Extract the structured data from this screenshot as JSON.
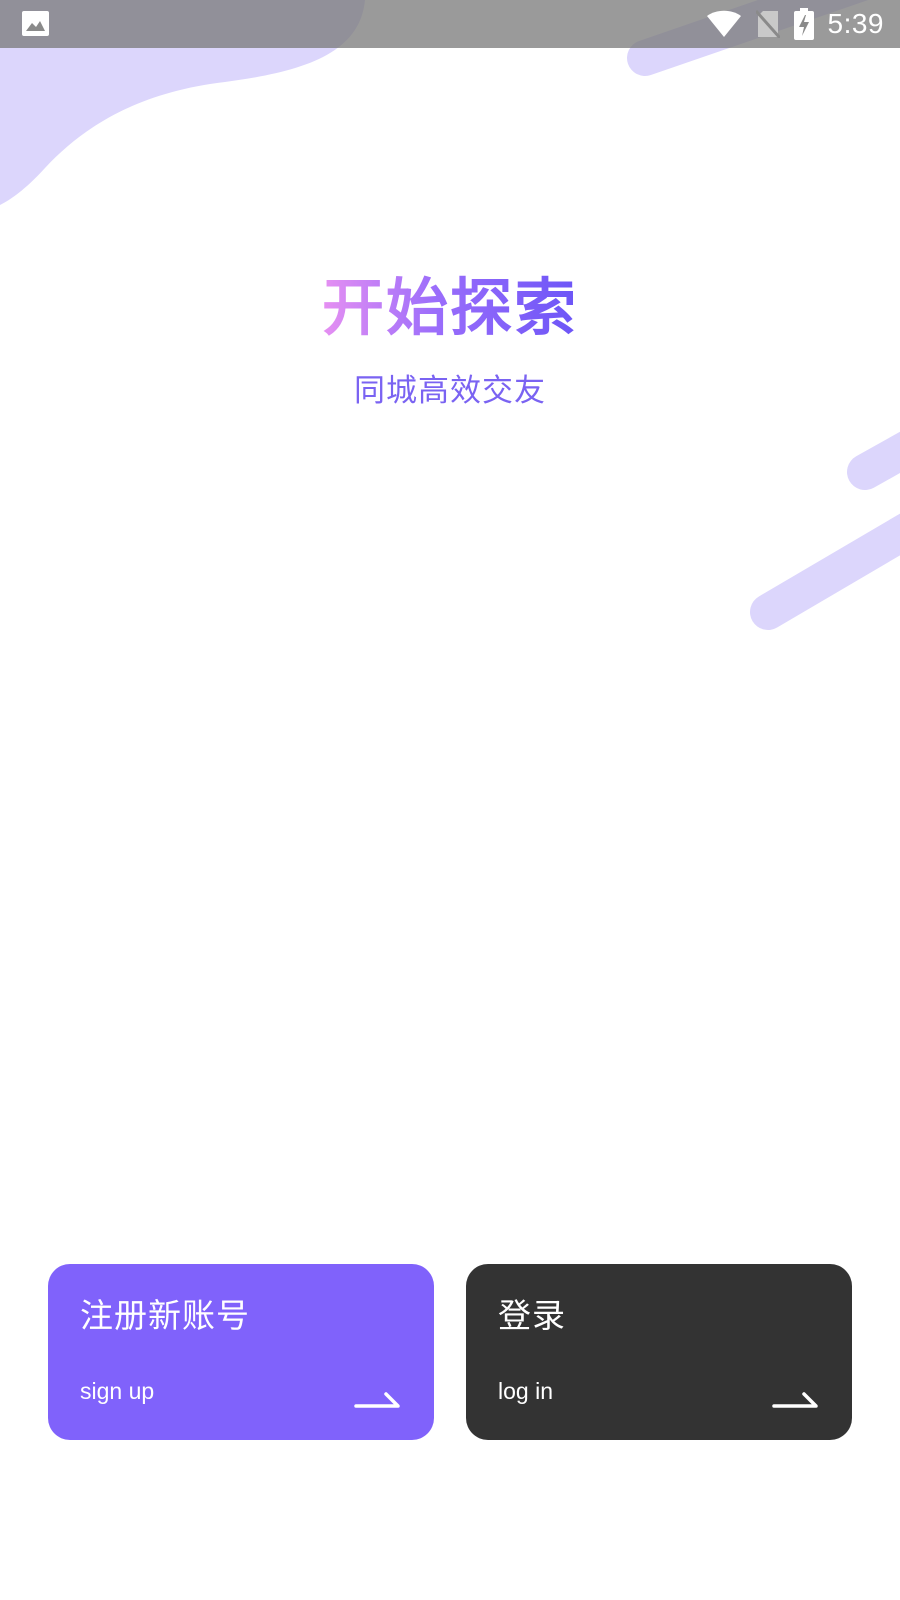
{
  "status_bar": {
    "time": "5:39",
    "left_icon": "image-icon",
    "right_icons": [
      "wifi-icon",
      "no-sim-icon",
      "battery-charging-icon"
    ]
  },
  "hero": {
    "title": "开始探索",
    "subtitle": "同城高效交友"
  },
  "actions": {
    "signup": {
      "title": "注册新账号",
      "subtitle": "sign up",
      "icon": "arrow-right-icon"
    },
    "login": {
      "title": "登录",
      "subtitle": "log in",
      "icon": "arrow-right-icon"
    }
  },
  "colors": {
    "accent": "#8062fb",
    "login_card": "#333333",
    "subtitle_text": "#7a63f2",
    "title_gradient_start": "#e690f2",
    "title_gradient_end": "#6c55f7",
    "decoration": "#dcd6fc"
  }
}
